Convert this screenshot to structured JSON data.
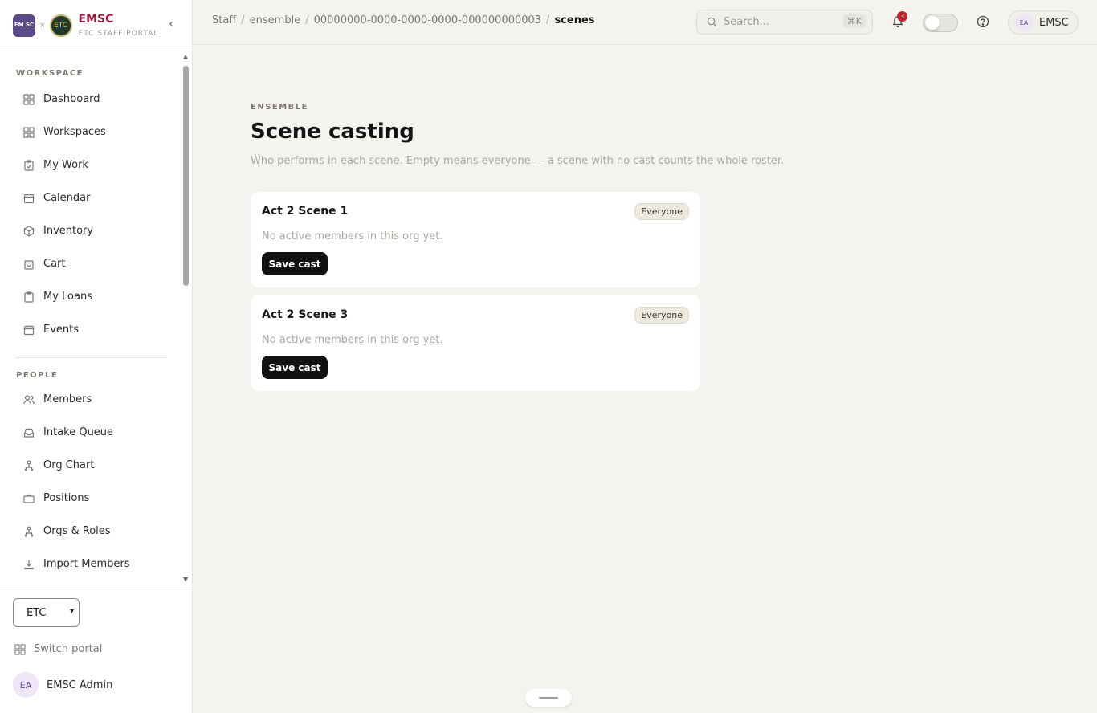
{
  "brand": {
    "logo_text": "EM SC",
    "separator": "×",
    "etc_logo": "ETC",
    "name": "EMSC",
    "subtitle": "ETC STAFF PORTAL"
  },
  "sidebar": {
    "sections": [
      {
        "title": "WORKSPACE",
        "items": [
          {
            "label": "Dashboard",
            "icon": "grid-icon"
          },
          {
            "label": "Workspaces",
            "icon": "grid-icon"
          },
          {
            "label": "My Work",
            "icon": "clipboard-icon"
          },
          {
            "label": "Calendar",
            "icon": "calendar-icon"
          },
          {
            "label": "Inventory",
            "icon": "box-icon"
          },
          {
            "label": "Cart",
            "icon": "bag-icon"
          },
          {
            "label": "My Loans",
            "icon": "clipboard-icon"
          },
          {
            "label": "Events",
            "icon": "calendar-icon"
          }
        ]
      },
      {
        "title": "PEOPLE",
        "items": [
          {
            "label": "Members",
            "icon": "users-icon"
          },
          {
            "label": "Intake Queue",
            "icon": "inbox-icon"
          },
          {
            "label": "Org Chart",
            "icon": "org-icon"
          },
          {
            "label": "Positions",
            "icon": "briefcase-icon"
          },
          {
            "label": "Orgs & Roles",
            "icon": "org-icon"
          },
          {
            "label": "Import Members",
            "icon": "download-icon"
          }
        ]
      }
    ],
    "org_select": "ETC",
    "switch_portal": "Switch portal",
    "user": {
      "initials": "EA",
      "name": "EMSC Admin"
    }
  },
  "topbar": {
    "breadcrumb": [
      "Staff",
      "ensemble",
      "00000000-0000-0000-0000-000000000003",
      "scenes"
    ],
    "search_placeholder": "Search...",
    "search_shortcut": "⌘K",
    "notification_count": "3",
    "user_initials": "EA",
    "user_name": "EMSC"
  },
  "main": {
    "eyebrow": "ENSEMBLE",
    "title": "Scene casting",
    "subtitle": "Who performs in each scene. Empty means everyone — a scene with no cast counts the whole roster.",
    "scenes": [
      {
        "title": "Act 2 Scene 1",
        "badge": "Everyone",
        "empty_text": "No active members in this org yet.",
        "button": "Save cast"
      },
      {
        "title": "Act 2 Scene 3",
        "badge": "Everyone",
        "empty_text": "No active members in this org yet.",
        "button": "Save cast"
      }
    ]
  },
  "colors": {
    "brand": "#9a1b3c",
    "background": "#f4f3ef",
    "button": "#111111",
    "badge": "#c8232c"
  }
}
